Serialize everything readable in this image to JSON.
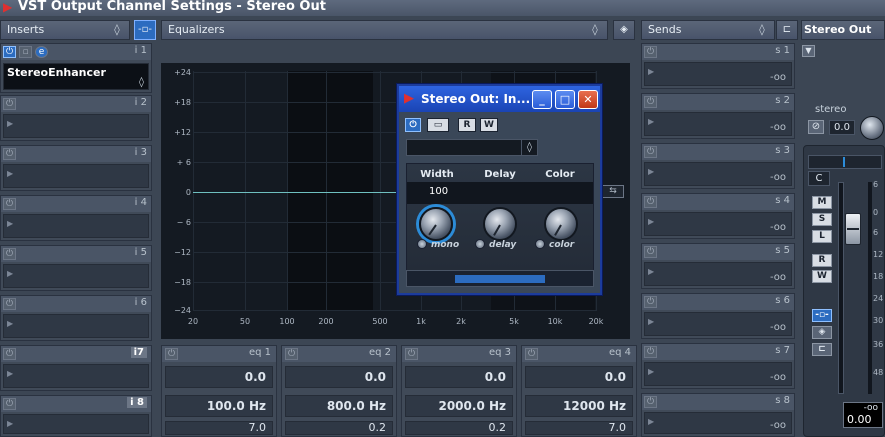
{
  "window": {
    "title": "VST Output Channel Settings - Stereo Out"
  },
  "sections": {
    "inserts": "Inserts",
    "equalizers": "Equalizers",
    "sends": "Sends",
    "channel": "Stereo Out"
  },
  "inserts": [
    {
      "label": "i 1",
      "plugin": "StereoEnhancer"
    },
    {
      "label": "i 2",
      "plugin": ""
    },
    {
      "label": "i 3",
      "plugin": ""
    },
    {
      "label": "i 4",
      "plugin": ""
    },
    {
      "label": "i 5",
      "plugin": ""
    },
    {
      "label": "i 6",
      "plugin": ""
    },
    {
      "label": "i7",
      "plugin": ""
    },
    {
      "label": "i 8",
      "plugin": ""
    }
  ],
  "sends": [
    {
      "label": "s 1",
      "value": "-oo"
    },
    {
      "label": "s 2",
      "value": "-oo"
    },
    {
      "label": "s 3",
      "value": "-oo"
    },
    {
      "label": "s 4",
      "value": "-oo"
    },
    {
      "label": "s 5",
      "value": "-oo"
    },
    {
      "label": "s 6",
      "value": "-oo"
    },
    {
      "label": "s 7",
      "value": "-oo"
    },
    {
      "label": "s 8",
      "value": "-oo"
    }
  ],
  "eq_display": {
    "y_ticks": [
      "+24",
      "+18",
      "+12",
      "+ 6",
      "0",
      "− 6",
      "−12",
      "−18",
      "−24"
    ],
    "x_ticks": [
      "20",
      "50",
      "100",
      "200",
      "500",
      "1k",
      "2k",
      "5k",
      "10k",
      "20k"
    ]
  },
  "eq_bands": [
    {
      "label": "eq 1",
      "gain": "0.0",
      "freq": "100.0 Hz",
      "q": "7.0"
    },
    {
      "label": "eq 2",
      "gain": "0.0",
      "freq": "800.0 Hz",
      "q": "0.2"
    },
    {
      "label": "eq 3",
      "gain": "0.0",
      "freq": "2000.0 Hz",
      "q": "0.2"
    },
    {
      "label": "eq 4",
      "gain": "0.0",
      "freq": "12000 Hz",
      "q": "7.0"
    }
  ],
  "channel_strip": {
    "pan_label": "stereo",
    "pan_value": "0.0",
    "pan_position": "C",
    "level_value": "0.00",
    "meter_value": "-oo",
    "buttons": {
      "mute": "M",
      "solo": "S",
      "listen": "L",
      "read": "R",
      "write": "W"
    },
    "fader_scale": [
      "6",
      "0",
      "6",
      "12",
      "18",
      "24",
      "30",
      "36",
      "48"
    ]
  },
  "plugin_window": {
    "title": "Stereo Out: In...",
    "toolbar": {
      "read": "R",
      "write": "W"
    },
    "params": [
      {
        "label": "Width",
        "value": "100"
      },
      {
        "label": "Delay"
      },
      {
        "label": "Color"
      }
    ],
    "switches": [
      "mono",
      "delay",
      "color"
    ]
  }
}
